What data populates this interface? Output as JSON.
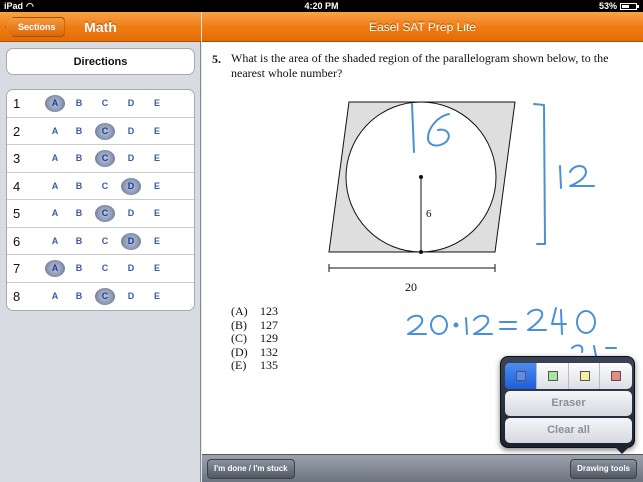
{
  "status": {
    "carrier": "iPad",
    "time": "4:20 PM",
    "battery": "53%"
  },
  "left": {
    "back_label": "Sections",
    "title": "Math",
    "directions_label": "Directions",
    "answers": [
      {
        "num": "1",
        "choices": [
          "A",
          "B",
          "C",
          "D",
          "E"
        ],
        "selected": "A"
      },
      {
        "num": "2",
        "choices": [
          "A",
          "B",
          "C",
          "D",
          "E"
        ],
        "selected": "C"
      },
      {
        "num": "3",
        "choices": [
          "A",
          "B",
          "C",
          "D",
          "E"
        ],
        "selected": "C"
      },
      {
        "num": "4",
        "choices": [
          "A",
          "B",
          "C",
          "D",
          "E"
        ],
        "selected": "D"
      },
      {
        "num": "5",
        "choices": [
          "A",
          "B",
          "C",
          "D",
          "E"
        ],
        "selected": "C"
      },
      {
        "num": "6",
        "choices": [
          "A",
          "B",
          "C",
          "D",
          "E"
        ],
        "selected": "D"
      },
      {
        "num": "7",
        "choices": [
          "A",
          "B",
          "C",
          "D",
          "E"
        ],
        "selected": "A"
      },
      {
        "num": "8",
        "choices": [
          "A",
          "B",
          "C",
          "D",
          "E"
        ],
        "selected": "C"
      }
    ]
  },
  "right": {
    "title": "Easel SAT Prep Lite",
    "question_number": "5.",
    "question_text": "What is the area of the shaded region of the parallelogram shown below, to the nearest whole number?",
    "figure": {
      "radius_label": "6",
      "base_label": "20"
    },
    "options": [
      {
        "letter": "(A)",
        "value": "123"
      },
      {
        "letter": "(B)",
        "value": "127"
      },
      {
        "letter": "(C)",
        "value": "129"
      },
      {
        "letter": "(D)",
        "value": "132"
      },
      {
        "letter": "(E)",
        "value": "135"
      }
    ],
    "handwriting": {
      "diameter": "16",
      "height": "12",
      "equation": "20·12=240"
    }
  },
  "toolbar": {
    "done_label": "I'm done / I'm stuck",
    "drawing_tools_label": "Drawing tools"
  },
  "drawing_tools": {
    "colors": [
      {
        "name": "blue",
        "hex": "#5b8cf0",
        "active": true
      },
      {
        "name": "green",
        "hex": "#a8e6a0",
        "active": false
      },
      {
        "name": "yellow",
        "hex": "#f3f0a0",
        "active": false
      },
      {
        "name": "red",
        "hex": "#e88a8a",
        "active": false
      }
    ],
    "eraser_label": "Eraser",
    "clear_label": "Clear all"
  },
  "colors": {
    "accent": "#f07d14",
    "ink": "#4a90d9"
  }
}
